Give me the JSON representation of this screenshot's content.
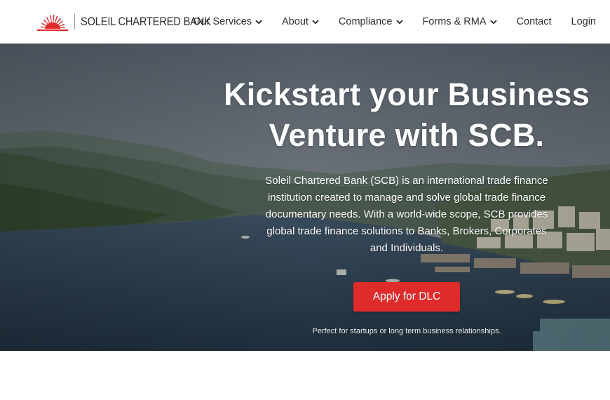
{
  "brand": {
    "name": "SOLEIL CHARTERED BANK",
    "logo_icon": "sunburst-logo-icon",
    "accent_color": "#e02b2b"
  },
  "nav": {
    "items": [
      {
        "label": "Our Services",
        "has_dropdown": true
      },
      {
        "label": "About",
        "has_dropdown": true
      },
      {
        "label": "Compliance",
        "has_dropdown": true
      },
      {
        "label": "Forms & RMA",
        "has_dropdown": true
      },
      {
        "label": "Contact",
        "has_dropdown": false
      },
      {
        "label": "Login",
        "has_dropdown": false
      }
    ],
    "dropdown_icon": "chevron-down-icon"
  },
  "hero": {
    "headline_line1": "Kickstart your Business",
    "headline_line2": "Venture with SCB.",
    "description": "Soleil Chartered Bank (SCB) is an international trade finance institution created to manage and solve global trade finance documentary needs. With a world-wide scope, SCB provides global trade finance solutions to Banks, Brokers, Corporates and Individuals.",
    "cta_label": "Apply for DLC",
    "cta_note": "Perfect for startups or long term business relationships.",
    "background": "harbor-village-photo"
  }
}
